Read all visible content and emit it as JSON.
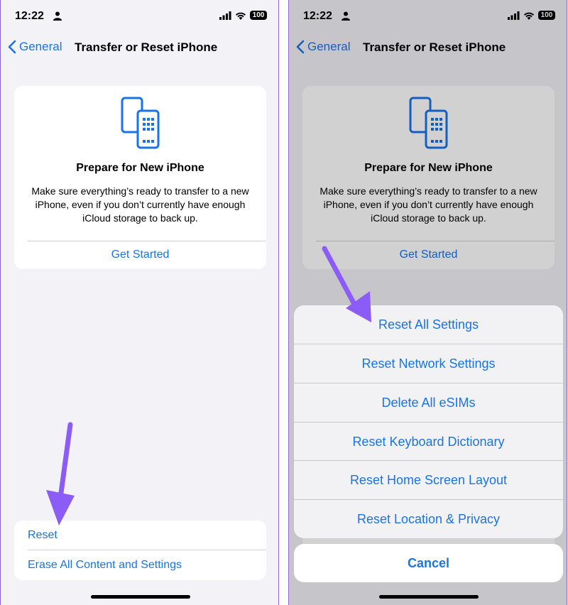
{
  "status": {
    "time": "12:22",
    "battery": "100"
  },
  "nav": {
    "back_label": "General",
    "title": "Transfer or Reset iPhone"
  },
  "card": {
    "title": "Prepare for New iPhone",
    "description": "Make sure everything’s ready to transfer to a new iPhone, even if you don’t currently have enough iCloud storage to back up.",
    "button": "Get Started"
  },
  "group": {
    "items": [
      "Reset",
      "Erase All Content and Settings"
    ]
  },
  "sheet": {
    "items": [
      "Reset All Settings",
      "Reset Network Settings",
      "Delete All eSIMs",
      "Reset Keyboard Dictionary",
      "Reset Home Screen Layout",
      "Reset Location & Privacy"
    ],
    "cancel": "Cancel"
  },
  "colors": {
    "accent": "#1a73e8",
    "annotation_arrow": "#8b5cf6",
    "background": "#f2f2f7"
  },
  "icons": [
    "person-icon",
    "signal-icon",
    "wifi-icon",
    "battery-icon",
    "chevron-left-icon",
    "phones-transfer-icon",
    "annotation-arrow"
  ]
}
